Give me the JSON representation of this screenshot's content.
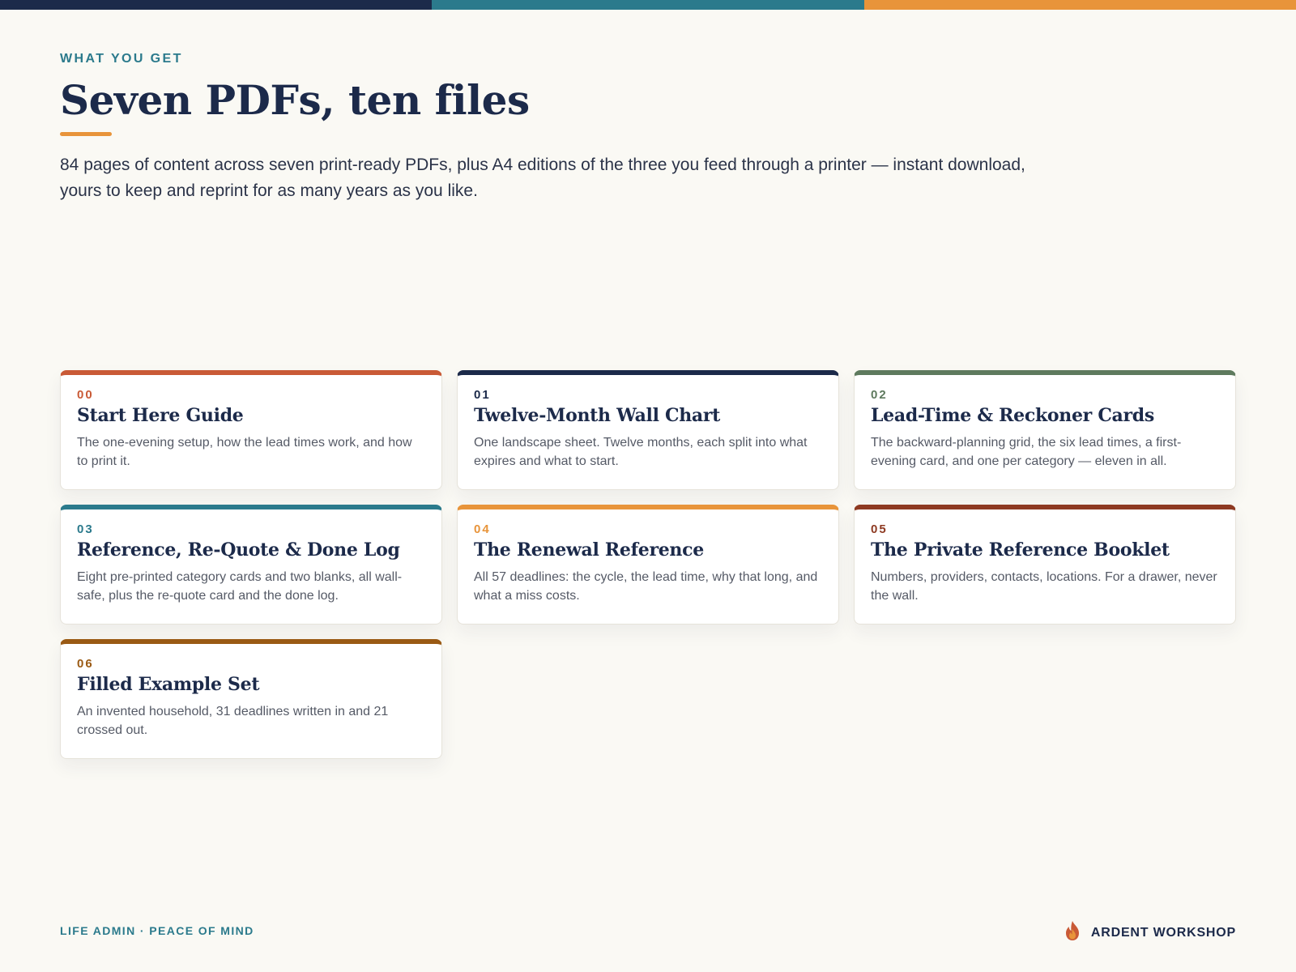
{
  "colors": {
    "background": "#faf9f4",
    "navy": "#1c2a4a",
    "teal": "#2b7a8c",
    "orange": "#e8943a"
  },
  "top_bar": [
    "#1c2a4a",
    "#2b7a8c",
    "#e8943a"
  ],
  "header": {
    "eyebrow": "WHAT YOU GET",
    "title": "Seven PDFs, ten files",
    "intro": "84 pages of content across seven print-ready PDFs, plus A4 editions of the three you feed through a printer — instant download, yours to keep and reprint for as many years as you like."
  },
  "cards": [
    {
      "number": "00",
      "title": "Start Here Guide",
      "description": "The one-evening setup, how the lead times work, and how to print it.",
      "accent": "#c95a36"
    },
    {
      "number": "01",
      "title": "Twelve-Month Wall Chart",
      "description": "One landscape sheet. Twelve months, each split into what expires and what to start.",
      "accent": "#1c2a4a"
    },
    {
      "number": "02",
      "title": "Lead-Time & Reckoner Cards",
      "description": "The backward-planning grid, the six lead times, a first-evening card, and one per category — eleven in all.",
      "accent": "#5e7a5e"
    },
    {
      "number": "03",
      "title": "Reference, Re-Quote & Done Log",
      "description": "Eight pre-printed category cards and two blanks, all wall-safe, plus the re-quote card and the done log.",
      "accent": "#2b7a8c"
    },
    {
      "number": "04",
      "title": "The Renewal Reference",
      "description": "All 57 deadlines: the cycle, the lead time, why that long, and what a miss costs.",
      "accent": "#e8943a"
    },
    {
      "number": "05",
      "title": "The Private Reference Booklet",
      "description": "Numbers, providers, contacts, locations. For a drawer, never the wall.",
      "accent": "#8e3a22"
    },
    {
      "number": "06",
      "title": "Filled Example Set",
      "description": "An invented household, 31 deadlines written in and 21 crossed out.",
      "accent": "#9a5a14"
    }
  ],
  "footer": {
    "tagline": "LIFE ADMIN · PEACE OF MIND",
    "brand": "ARDENT WORKSHOP",
    "brand_icon": "flame-icon"
  }
}
